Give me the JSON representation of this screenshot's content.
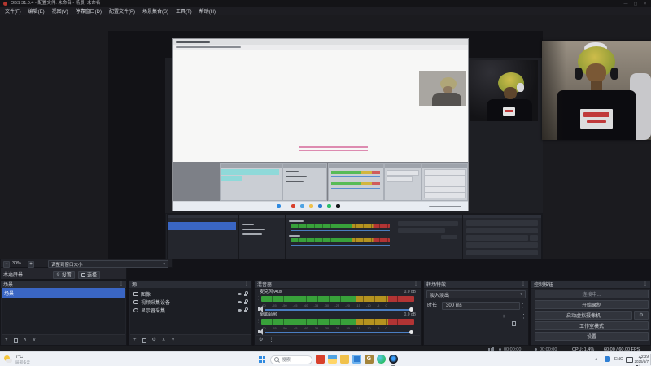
{
  "titlebar": {
    "title": "OBS 31.0.4 - 配置文件: 未命名 - 场景: 未命名"
  },
  "menus": [
    "文件(F)",
    "编辑(E)",
    "视图(V)",
    "停靠窗口(D)",
    "配置文件(P)",
    "场景集合(S)",
    "工具(T)",
    "帮助(H)"
  ],
  "preview_dock": {
    "zoom_level": "30%",
    "fit_mode": "调整到窗口大小",
    "status": "未选屏幕",
    "settings": "设置",
    "select": "选择"
  },
  "scenes": {
    "title": "场景",
    "items": [
      "场景"
    ]
  },
  "sources": {
    "title": "源",
    "items": [
      "图像",
      "视频采集设备",
      "显示器采集"
    ]
  },
  "mixer": {
    "title": "混音器",
    "channels": [
      {
        "name": "麦克风/Aux",
        "db": "0.0 dB",
        "volume_percent": 100
      },
      {
        "name": "桌面音频",
        "db": "0.0 dB",
        "volume_percent": 100
      }
    ],
    "ticks": "-60 -55 -50 -45 -40 -35 -30 -25 -20 -15 -10 -5 0"
  },
  "transitions": {
    "title": "转场特效",
    "selected": "淡入淡出",
    "duration_label": "时长",
    "duration": "300 ms"
  },
  "controls": {
    "title": "控制按钮",
    "stream_button": "连接中...",
    "record_button": "开始录制",
    "vcam_button": "启动虚拟摄像机",
    "studio_button": "工作室模式",
    "settings_button": "设置"
  },
  "statusbar": {
    "stream_time": "00:00:00",
    "rec_time": "00:00:00",
    "cpu": "CPU: 1.4%",
    "fps": "60.00 / 60.00 FPS"
  },
  "taskbar": {
    "weather": {
      "temp": "7°C",
      "desc": "局部多云"
    },
    "search": "搜索",
    "app_icons": [
      "red-media-app",
      "file-explorer",
      "folder",
      "blue-app",
      "g-app",
      "browser",
      "obs-dark-app"
    ],
    "g_label": "G",
    "tray": {
      "lang": "ENG",
      "time": "23:39",
      "date": "2025/5/7"
    }
  },
  "icons": {
    "minus": "−",
    "plus": "+",
    "up": "∧",
    "down": "∨",
    "more": "⋮",
    "gear": "⚙",
    "dropdown": "▾",
    "spin_up": "▴",
    "spin_down": "▾",
    "minimize": "—",
    "maximize": "▢",
    "close": "×",
    "tray_chevron": "∧"
  },
  "colors": {
    "accent_blue": "#3a66c4",
    "selection_cyan": "#8fd9d9",
    "meter_green": "#38a13a",
    "meter_yellow": "#b4921f",
    "meter_red": "#b23434"
  }
}
